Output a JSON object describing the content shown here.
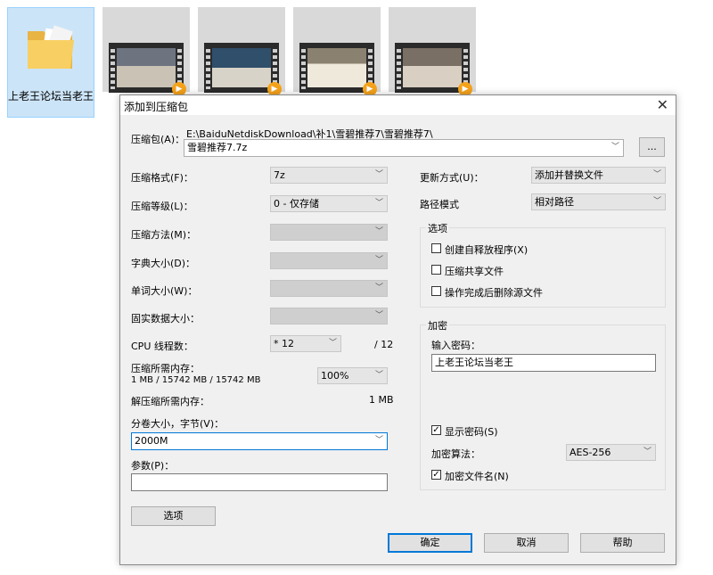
{
  "desktop": {
    "folder_label": "上老王论坛当老王",
    "video_count": 4
  },
  "dialog": {
    "title": "添加到压缩包",
    "archive_label": "压缩包(A)：",
    "archive_path": "E:\\BaiduNetdiskDownload\\补1\\雪碧推荐7\\雪碧推荐7\\",
    "archive_name": "雪碧推荐7.7z",
    "browse_label": "...",
    "format_label": "压缩格式(F)：",
    "format_value": "7z",
    "level_label": "压缩等级(L)：",
    "level_value": "0 - 仅存储",
    "method_label": "压缩方法(M)：",
    "dict_label": "字典大小(D)：",
    "word_label": "单词大小(W)：",
    "solid_label": "固实数据大小：",
    "cpu_label": "CPU 线程数：",
    "cpu_value": "* 12",
    "cpu_total": "/ 12",
    "mem_compress_label": "压缩所需内存：",
    "mem_compress_value": "1 MB / 15742 MB / 15742 MB",
    "mem_percent": "100%",
    "mem_decompress_label": "解压缩所需内存：",
    "mem_decompress_value": "1 MB",
    "volume_label": "分卷大小，字节(V)：",
    "volume_value": "2000M",
    "params_label": "参数(P)：",
    "params_value": "",
    "options_button": "选项",
    "update_label": "更新方式(U)：",
    "update_value": "添加并替换文件",
    "path_label": "路径模式",
    "path_value": "相对路径",
    "options_group": {
      "title": "选项",
      "items": [
        {
          "label": "创建自释放程序(X)",
          "checked": false
        },
        {
          "label": "压缩共享文件",
          "checked": false
        },
        {
          "label": "操作完成后删除源文件",
          "checked": false
        }
      ]
    },
    "encrypt_group": {
      "title": "加密",
      "password_label": "输入密码：",
      "password_value": "上老王论坛当老王",
      "show_password": {
        "label": "显示密码(S)",
        "checked": true
      },
      "algo_label": "加密算法：",
      "algo_value": "AES-256",
      "encrypt_names": {
        "label": "加密文件名(N)",
        "checked": true
      }
    },
    "ok_button": "确定",
    "cancel_button": "取消",
    "help_button": "帮助",
    "check_mark": "✓",
    "arrow_glyph": "﹀"
  }
}
